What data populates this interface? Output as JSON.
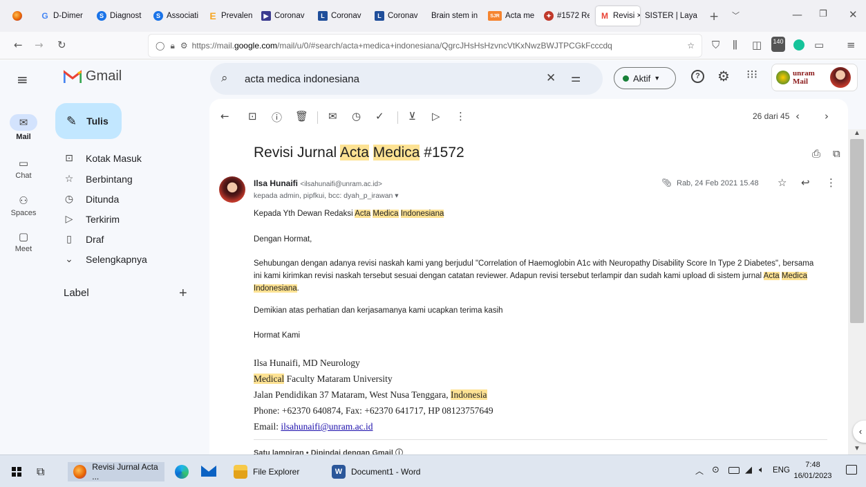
{
  "browser": {
    "tabs": [
      {
        "label": "",
        "color": "#e66000"
      },
      {
        "label": "D-Dimer",
        "icon": "G",
        "color": "#4285f4"
      },
      {
        "label": "Diagnost",
        "icon": "S",
        "color": "#1a73e8"
      },
      {
        "label": "Associati",
        "icon": "S",
        "color": "#1a73e8"
      },
      {
        "label": "Prevalen",
        "icon": "E",
        "color": "#f5a623"
      },
      {
        "label": "Coronav",
        "icon": "▶",
        "color": "#3b3b8f"
      },
      {
        "label": "Coronav",
        "icon": "L",
        "color": "#1f4e9a"
      },
      {
        "label": "Coronav",
        "icon": "L",
        "color": "#1f4e9a"
      },
      {
        "label": "Brain stem in",
        "icon": "",
        "color": "#ffffff"
      },
      {
        "label": "Acta me",
        "icon": "SJR",
        "color": "#f5842f"
      },
      {
        "label": "#1572 Re",
        "icon": "✦",
        "color": "#c0392b"
      },
      {
        "label": "Revisi ×",
        "icon": "M",
        "color": "#ea4335"
      },
      {
        "label": "SISTER | Laya",
        "icon": "",
        "color": "#ffffff"
      }
    ],
    "url_prefix": "https://mail.",
    "url_domain": "google.com",
    "url_path": "/mail/u/0/#search/acta+medica+indonesiana/QgrcJHsHsHzvncVtKxNwzBWJTPCGkFcccdq",
    "badge": "140"
  },
  "gmail": {
    "logo": "Gmail",
    "search_query": "acta medica indonesiana",
    "status": "Aktif",
    "org_logo": "unram Mail",
    "rail": [
      {
        "label": "Mail",
        "icon": "mail-icon"
      },
      {
        "label": "Chat",
        "icon": "chat-icon"
      },
      {
        "label": "Spaces",
        "icon": "spaces-icon"
      },
      {
        "label": "Meet",
        "icon": "meet-icon"
      }
    ],
    "compose": "Tulis",
    "nav": [
      "Kotak Masuk",
      "Berbintang",
      "Ditunda",
      "Terkirim",
      "Draf",
      "Selengkapnya"
    ],
    "label_header": "Label",
    "pagination": "26 dari 45",
    "subject_pre": "Revisi Jurnal ",
    "subject_hl1": "Acta",
    "subject_hl2": "Medica",
    "subject_post": " #1572",
    "sender_name": "Ilsa Hunaifi",
    "sender_email": "<ilsahunaifi@unram.ac.id>",
    "recipients": "kepada admin, pipfkui, bcc: dyah_p_irawan ▾",
    "date": "Rab, 24 Feb 2021 15.48",
    "greeting_pre": "Kepada Yth Dewan Redaksi ",
    "greeting_h1": "Acta",
    "greeting_h2": "Medica",
    "greeting_h3": "Indonesiana",
    "line_hormat": "Dengan Hormat,",
    "para_1": "Sehubungan dengan adanya revisi naskah kami yang berjudul \"Correlation of Haemoglobin A1c with Neuropathy Disability Score In Type 2 Diabetes\", bersama",
    "para_2": "ini kami kirimkan revisi naskah tersebut sesuai dengan catatan reviewer. Adapun revisi tersebut terlampir dan sudah kami upload di sistem jurnal ",
    "para_2_h1": "Acta",
    "para_2_h2": "Medica",
    "para_3_h": "Indonesiana",
    "para_3_end": ".",
    "line_thanks": "Demikian atas perhatian dan kerjasamanya kami ucapkan terima kasih",
    "line_closing": "Hormat Kami",
    "sig_name": "Ilsa Hunaifi, MD Neurology",
    "sig_faculty_h": "Medical",
    "sig_faculty": " Faculty Mataram University",
    "sig_address_pre": "Jalan Pendidikan 37 Mataram, West Nusa Tenggara, ",
    "sig_address_h": "Indonesia",
    "sig_phone": "Phone: +62370 640874, Fax: +62370 641717, HP 08123757649",
    "sig_email_label": "Email: ",
    "sig_email": "ilsahunaifi@unram.ac.id",
    "attachment_row": "Satu lampiran • Dipindai dengan Gmail ⓘ"
  },
  "taskbar": {
    "items": [
      "Revisi Jurnal Acta ...",
      "File Explorer",
      "Document1 - Word"
    ],
    "lang": "ENG",
    "time": "7:48",
    "date": "16/01/2023"
  },
  "colors": {
    "highlight": "#fde293",
    "gmail_red": "#ea4335",
    "compose_bg": "#c2e7ff",
    "active_dot": "#188038"
  }
}
